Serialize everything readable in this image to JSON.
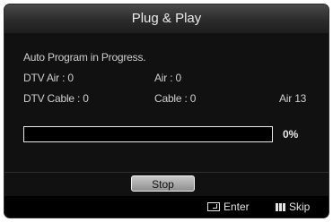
{
  "dialog": {
    "title": "Plug & Play"
  },
  "status": {
    "message": "Auto Program in Progress.",
    "dtv_air": "DTV Air : 0",
    "air": "Air : 0",
    "dtv_cable": "DTV Cable : 0",
    "cable": "Cable : 0",
    "current_channel": "Air 13"
  },
  "progress": {
    "value": 0,
    "label": "0%"
  },
  "buttons": {
    "stop_label": "Stop"
  },
  "footer": {
    "enter_label": "Enter",
    "skip_label": "Skip"
  },
  "icons": {
    "enter": "enter-icon",
    "skip": "skip-icon"
  }
}
